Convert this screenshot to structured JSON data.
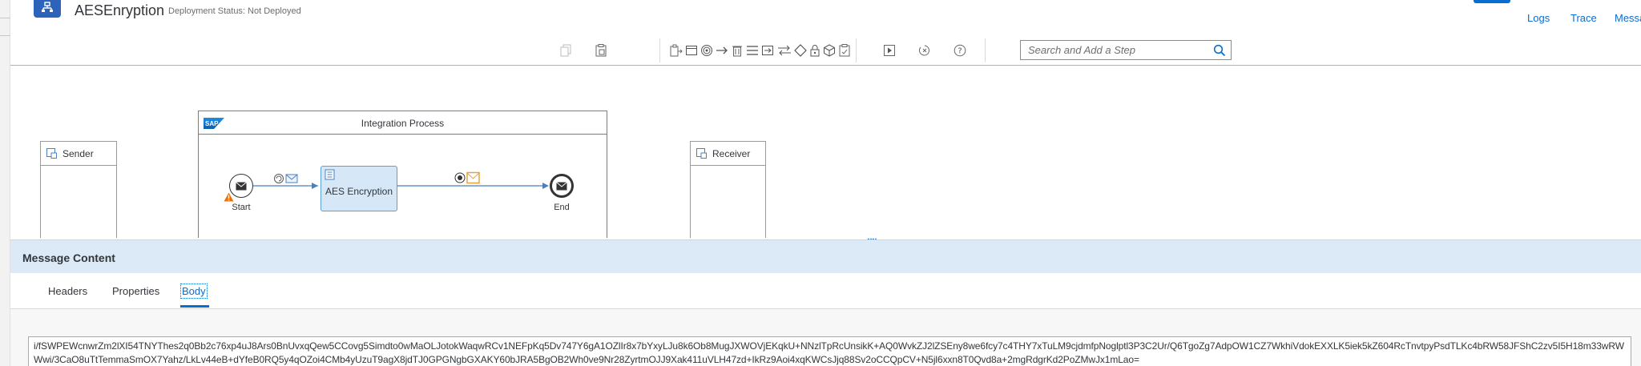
{
  "header": {
    "title": "AESEnryption",
    "deployment_status": "Deployment Status: Not Deployed",
    "links": [
      "Logs",
      "Trace",
      "Messa"
    ]
  },
  "toolbar": {
    "search_placeholder": "Search and Add a Step",
    "icons": [
      "copy-icon",
      "paste-icon",
      "participants-icon",
      "process-icon",
      "events-icon",
      "connector-icon",
      "delete-icon",
      "mapping-icon",
      "transformation-icon",
      "call-icon",
      "routing-icon",
      "security-icon",
      "persistence-icon",
      "validator-icon",
      "simulation-run-icon",
      "cancel-simulation-icon",
      "help-icon",
      "search-icon"
    ]
  },
  "canvas": {
    "sender": {
      "label": "Sender"
    },
    "receiver": {
      "label": "Receiver"
    },
    "integration_process": {
      "title": "Integration Process",
      "logo": "SAP"
    },
    "start_event": {
      "label": "Start"
    },
    "end_event": {
      "label": "End"
    },
    "task": {
      "label": "AES Encryption"
    }
  },
  "message_panel": {
    "title": "Message Content",
    "tabs": [
      {
        "label": "Headers"
      },
      {
        "label": "Properties"
      },
      {
        "label": "Body"
      }
    ],
    "active_tab": "Body",
    "body": "i/fSWPEWcnwrZm2lXI54TNYThes2q0Bb2c76xp4uJ8Ars0BnUvxqQew5CCovg5Simdto0wMaOLJotokWaqwRCv1NEFpKq5Dv747Y6gA1OZlIr8x7bYxyLJu8k6Ob8MugJXWOVjEKqkU+NNzlTpRcUnsikK+AQ0WvkZJ2lZSEny8we6fcy7c4THY7xTuLM9cjdmfpNoglptl3P3C2Ur/Q6TgoZg7AdpOW1CZ7WkhiVdokEXXLK5iek5kZ604RcTnvtpyPsdTLKc4bRW58JFShC2zv5I5H18m33wRWWwi/3CaO8uTtTemmaSmOX7Yahz/LkLv44eB+dYfeB0RQ5y4qOZoi4CMb4yUzuT9agX8jdTJ0GPGNgbGXAKY60bJRA5BgOB2Wh0ve9Nr28ZyrtmOJJ9Xak411uVLH47zd+IkRz9Aoi4xqKWCsJjq88Sv2oCCQpCV+N5jl6xxn8T0Qvd8a+2mgRdgrKd2PoZMwJx1mLao="
  },
  "colors": {
    "accent": "#0a6ed1",
    "task_fill": "#d6e8f8",
    "warning": "#e9730c",
    "message_header_bg": "#dceaf8"
  }
}
